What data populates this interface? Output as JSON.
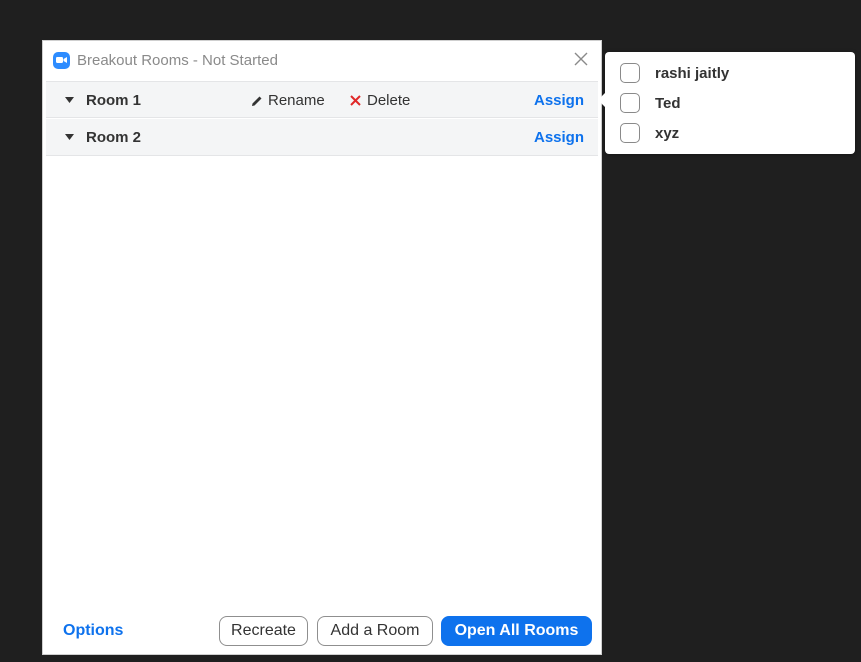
{
  "window": {
    "title": "Breakout Rooms - Not Started",
    "close_icon": "close-icon",
    "logo_icon": "zoom-logo-icon"
  },
  "rooms": [
    {
      "name": "Room 1",
      "rename_label": "Rename",
      "delete_label": "Delete",
      "assign_label": "Assign"
    },
    {
      "name": "Room 2",
      "assign_label": "Assign"
    }
  ],
  "footer": {
    "options_label": "Options",
    "recreate_label": "Recreate",
    "add_room_label": "Add a Room",
    "open_all_label": "Open All Rooms"
  },
  "assign_popover": {
    "participants": [
      {
        "name": "rashi jaitly",
        "checked": false
      },
      {
        "name": "Ted",
        "checked": false
      },
      {
        "name": "xyz",
        "checked": false
      }
    ]
  },
  "colors": {
    "background": "#1f1f1f",
    "accent": "#0e72ed",
    "delete_x": "#e02828",
    "row_bg": "#f4f5f6"
  }
}
